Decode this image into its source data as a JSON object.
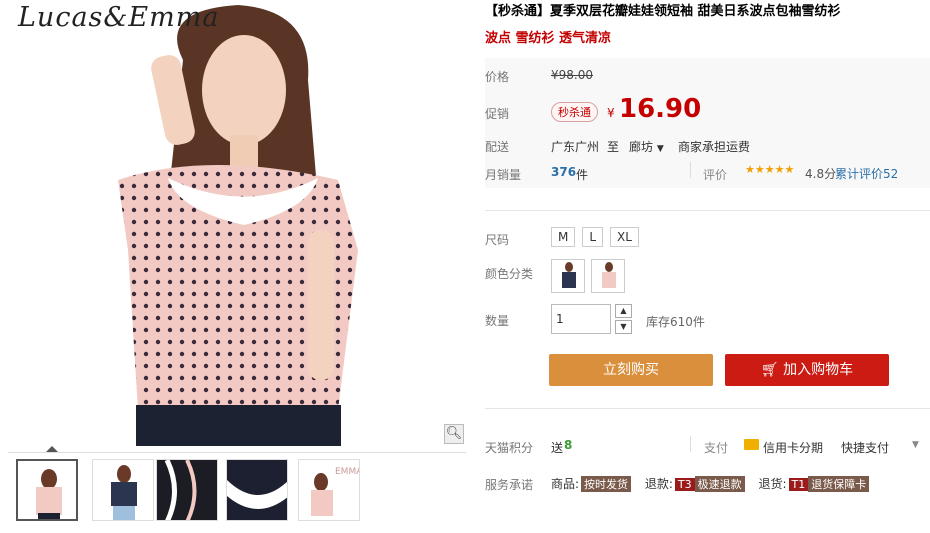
{
  "gallery": {
    "brand": "Lucas&Emma",
    "zoom_icon": "magnifier-icon",
    "thumb_label": "Lucas & Emma"
  },
  "product": {
    "title": "【秒杀通】夏季双层花瓣娃娃领短袖 甜美日系波点包袖雪纺衫",
    "subtitle": "波点 雪纺衫 透气清凉"
  },
  "price": {
    "label": "价格",
    "original": "¥98.00",
    "promo_label": "促销",
    "promo_tag": "秒杀通",
    "currency": "¥",
    "current": "16.90"
  },
  "shipping": {
    "label": "配送",
    "from": "广东广州",
    "to_word": "至",
    "dest": "廊坊",
    "fee": "商家承担运费"
  },
  "sales": {
    "label": "月销量",
    "count": "376",
    "unit": "件",
    "rating_label": "评价",
    "stars": "★★★★★",
    "score": "4.8分",
    "reviews": "累计评价52"
  },
  "options": {
    "size_label": "尺码",
    "sizes": [
      "M",
      "L",
      "XL"
    ],
    "color_label": "颜色分类",
    "qty_label": "数量",
    "qty_value": "1",
    "stock": "库存610件"
  },
  "actions": {
    "buy_now": "立刻购买",
    "add_cart": "加入购物车"
  },
  "points": {
    "label": "天猫积分",
    "prefix": "送",
    "value": "8",
    "pay_label": "支付",
    "card": "信用卡分期",
    "quick": "快捷支付"
  },
  "service": {
    "label": "服务承诺",
    "goods_prefix": "商品:",
    "goods_tag": "按时发货",
    "refund_prefix": "退款:",
    "refund_code": "T3",
    "refund_tag": "极速退款",
    "return_prefix": "退货:",
    "return_code": "T1",
    "return_tag": "退货保障卡"
  }
}
